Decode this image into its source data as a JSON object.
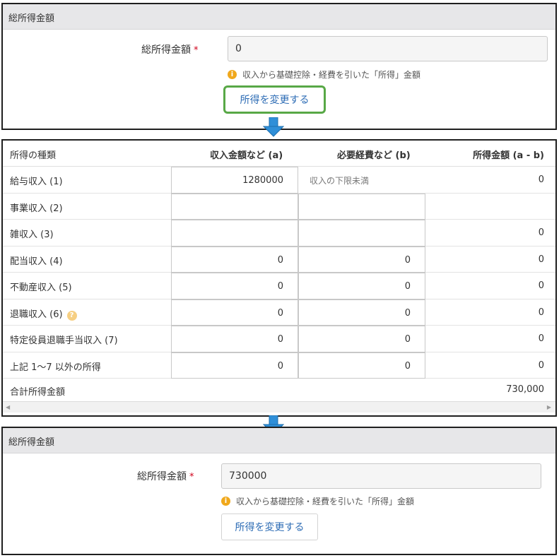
{
  "top_panel": {
    "section_title": "総所得金額",
    "field_label": "総所得金額",
    "required_mark": "*",
    "field_value": "0",
    "hint": "収入から基礎控除・経費を引いた「所得」金額",
    "change_button": "所得を変更する"
  },
  "income_table": {
    "headers": {
      "type": "所得の種類",
      "revenue": "収入金額など (a)",
      "expense": "必要経費など (b)",
      "income": "所得金額 (a - b)"
    },
    "rows": [
      {
        "label": "給与収入 (1)",
        "revenue": "1280000",
        "expense_note": "収入の下限未満",
        "income": "0"
      },
      {
        "label": "事業収入 (2)",
        "revenue": "",
        "expense": "",
        "income": ""
      },
      {
        "label": "雑収入 (3)",
        "revenue": "",
        "expense": "",
        "income": "0"
      },
      {
        "label": "配当収入 (4)",
        "revenue": "0",
        "expense": "0",
        "income": "0"
      },
      {
        "label": "不動産収入 (5)",
        "revenue": "0",
        "expense": "0",
        "income": "0"
      },
      {
        "label": "退職収入 (6)",
        "revenue": "0",
        "expense": "0",
        "income": "0",
        "help_icon": "question-icon"
      },
      {
        "label": "特定役員退職手当収入 (7)",
        "revenue": "0",
        "expense": "0",
        "income": "0"
      },
      {
        "label": "上記 1〜7 以外の所得",
        "revenue": "0",
        "expense": "0",
        "income": "0"
      }
    ],
    "total_label": "合計所得金額",
    "total_value": "730,000"
  },
  "bottom_panel": {
    "section_title": "総所得金額",
    "field_label": "総所得金額",
    "required_mark": "*",
    "field_value": "730000",
    "hint": "収入から基礎控除・経費を引いた「所得」金額",
    "change_button": "所得を変更する"
  },
  "colors": {
    "header_bg": "#e7e7e9",
    "highlight_border": "#58a846",
    "link_blue": "#2d6cb5",
    "arrow_blue": "#2f8fd8",
    "info_orange": "#f0a81c",
    "required_red": "#d0021b"
  }
}
